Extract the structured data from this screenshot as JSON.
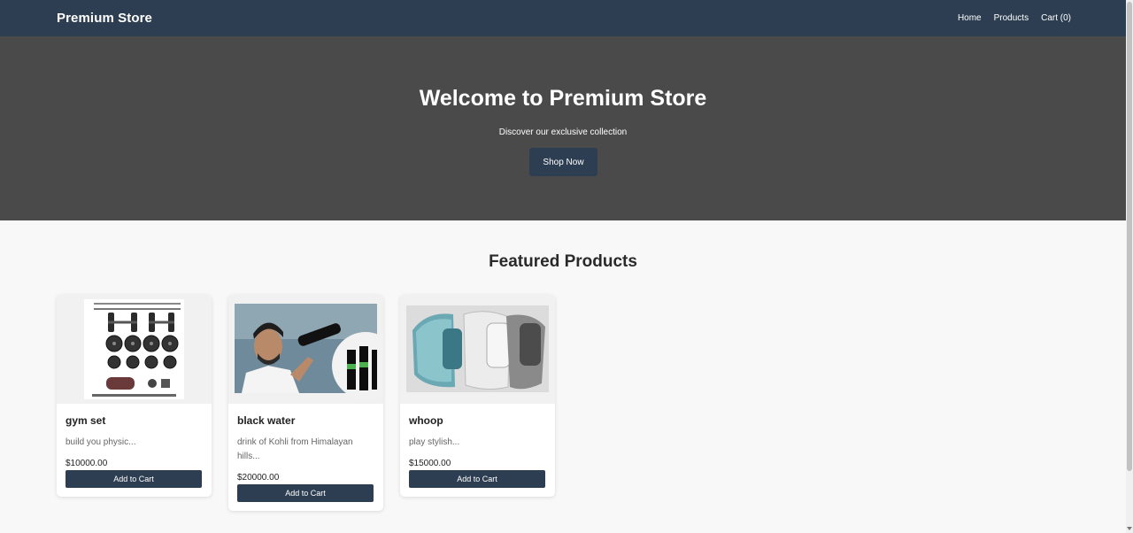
{
  "navbar": {
    "brand": "Premium Store",
    "links": [
      "Home",
      "Products",
      "Cart (0)"
    ]
  },
  "hero": {
    "title": "Welcome to Premium Store",
    "subtitle": "Discover our exclusive collection",
    "cta_label": "Shop Now"
  },
  "section": {
    "title": "Featured Products"
  },
  "products": [
    {
      "name": "gym set",
      "description": "build you physic...",
      "price": "$10000.00",
      "button_label": "Add to Cart",
      "image_icon": "dumbbell-set-image"
    },
    {
      "name": "black water",
      "description": "drink of Kohli from Himalayan hills...",
      "price": "$20000.00",
      "button_label": "Add to Cart",
      "image_icon": "athlete-drinking-image"
    },
    {
      "name": "whoop",
      "description": "play stylish...",
      "price": "$15000.00",
      "button_label": "Add to Cart",
      "image_icon": "fitness-bands-image"
    }
  ],
  "colors": {
    "navbar": "#2d3e52",
    "hero": "#4a4a4a",
    "button": "#2d3e52",
    "page_bg": "#f8f8f8"
  }
}
